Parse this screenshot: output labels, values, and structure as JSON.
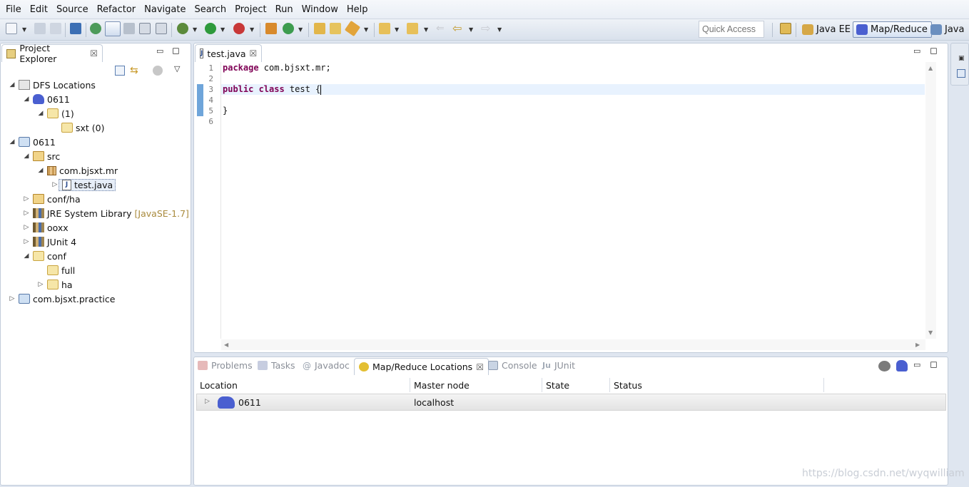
{
  "menubar": {
    "items": [
      "File",
      "Edit",
      "Source",
      "Refactor",
      "Navigate",
      "Search",
      "Project",
      "Run",
      "Window",
      "Help"
    ]
  },
  "toolbar": {
    "quick_access_placeholder": "Quick Access",
    "perspectives": [
      {
        "label": "Java EE",
        "icon": "java-ee-perspective-icon",
        "active": false
      },
      {
        "label": "Map/Reduce",
        "icon": "elephant-icon",
        "active": true
      },
      {
        "label": "Java",
        "icon": "java-perspective-icon",
        "active": false
      }
    ]
  },
  "project_explorer": {
    "title": "Project Explorer",
    "tree": [
      {
        "label": "DFS Locations",
        "depth": 0,
        "icon": "dfs-icon",
        "expanded": true
      },
      {
        "label": "0611",
        "depth": 1,
        "icon": "elephant-icon",
        "expanded": true
      },
      {
        "label": "(1)",
        "depth": 2,
        "icon": "folder-icon",
        "expanded": true
      },
      {
        "label": "sxt (0)",
        "depth": 3,
        "icon": "folder-icon",
        "expanded": null
      },
      {
        "label": "0611",
        "depth": 0,
        "icon": "project-folder-icon",
        "expanded": true
      },
      {
        "label": "src",
        "depth": 1,
        "icon": "package-folder-icon",
        "expanded": true
      },
      {
        "label": "com.bjsxt.mr",
        "depth": 2,
        "icon": "package-icon",
        "expanded": true
      },
      {
        "label": "test.java",
        "depth": 3,
        "icon": "java-file-icon",
        "expanded": false,
        "selected": true
      },
      {
        "label": "conf/ha",
        "depth": 1,
        "icon": "package-folder-icon",
        "expanded": false
      },
      {
        "label": "JRE System Library",
        "decoration": "[JavaSE-1.7]",
        "depth": 1,
        "icon": "library-icon",
        "expanded": false
      },
      {
        "label": "ooxx",
        "depth": 1,
        "icon": "library-icon",
        "expanded": false
      },
      {
        "label": "JUnit 4",
        "depth": 1,
        "icon": "library-icon",
        "expanded": false
      },
      {
        "label": "conf",
        "depth": 1,
        "icon": "folder-icon",
        "expanded": true
      },
      {
        "label": "full",
        "depth": 2,
        "icon": "folder-icon",
        "expanded": null
      },
      {
        "label": "ha",
        "depth": 2,
        "icon": "folder-icon",
        "expanded": false
      },
      {
        "label": "com.bjsxt.practice",
        "depth": 0,
        "icon": "project-folder-icon",
        "expanded": false
      }
    ]
  },
  "editor": {
    "tab_label": "test.java",
    "lines": [
      {
        "num": "1",
        "kw": "package",
        "rest": " com.bjsxt.mr;"
      },
      {
        "num": "2",
        "kw": "",
        "rest": ""
      },
      {
        "num": "3",
        "kw": "public class",
        "rest": " test {"
      },
      {
        "num": "4",
        "kw": "",
        "rest": ""
      },
      {
        "num": "5",
        "kw": "",
        "rest": "}"
      },
      {
        "num": "6",
        "kw": "",
        "rest": ""
      }
    ]
  },
  "bottom_panel": {
    "tabs": [
      {
        "label": "Problems",
        "icon": "problems-icon",
        "active": false
      },
      {
        "label": "Tasks",
        "icon": "tasks-icon",
        "active": false
      },
      {
        "label": "Javadoc",
        "icon": "javadoc-icon",
        "active": false
      },
      {
        "label": "Map/Reduce Locations",
        "icon": "mapreduce-icon",
        "active": true
      },
      {
        "label": "Console",
        "icon": "console-icon",
        "active": false
      },
      {
        "label": "JUnit",
        "icon": "junit-icon",
        "active": false
      }
    ],
    "columns": [
      "Location",
      "Master node",
      "State",
      "Status"
    ],
    "rows": [
      {
        "location": "0611",
        "master_node": "localhost",
        "state": "",
        "status": ""
      }
    ]
  },
  "watermark": "https://blog.csdn.net/wyqwilliam"
}
